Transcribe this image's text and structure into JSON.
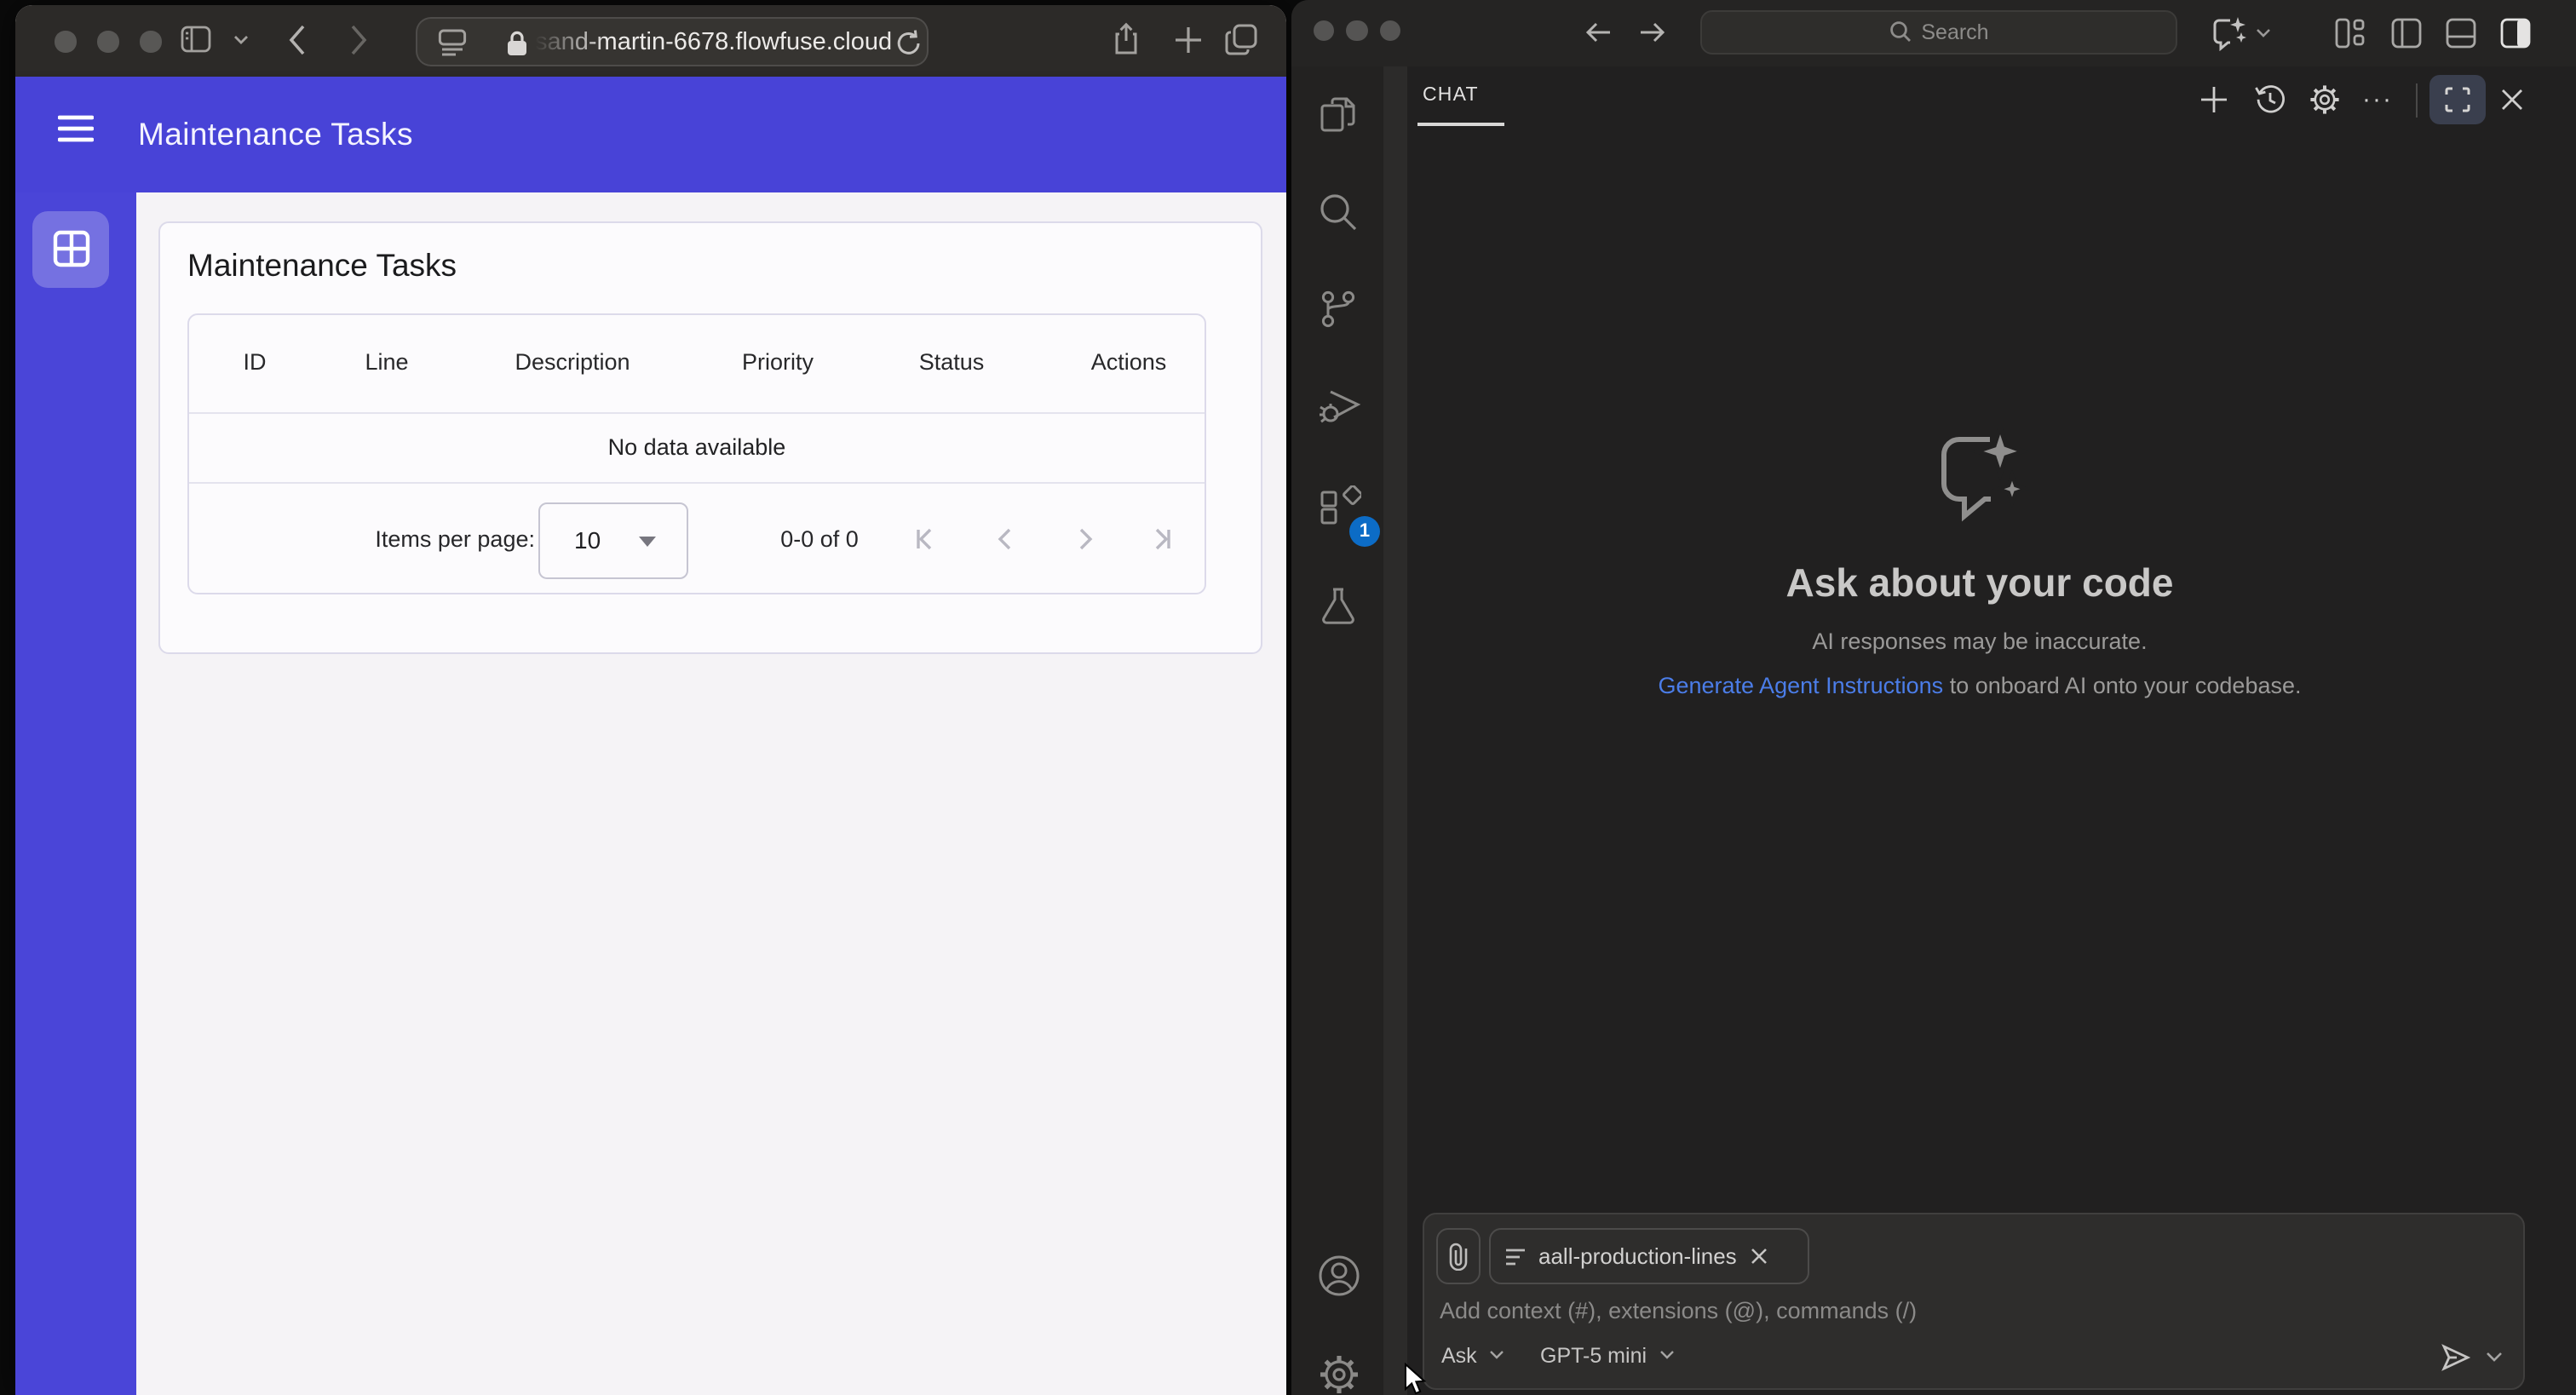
{
  "safari": {
    "url": "sand-martin-6678.flowfuse.cloud",
    "app": {
      "header_title": "Maintenance Tasks",
      "card_title": "Maintenance Tasks",
      "table": {
        "columns": [
          "ID",
          "Line",
          "Description",
          "Priority",
          "Status",
          "Actions"
        ],
        "empty_text": "No data available"
      },
      "pagination": {
        "items_per_page_label": "Items per page:",
        "items_per_page_value": "10",
        "range_text": "0-0 of 0"
      }
    },
    "colors": {
      "primary": "#4843d7"
    }
  },
  "vscode": {
    "titlebar": {
      "search_placeholder": "Search"
    },
    "activity_bar": {
      "extensions_badge": "1"
    },
    "chat": {
      "tab_label": "CHAT",
      "empty_title": "Ask about your code",
      "empty_subtitle": "AI responses may be inaccurate.",
      "empty_link": "Generate Agent Instructions",
      "empty_link_suffix": " to onboard AI onto your codebase.",
      "input": {
        "attachment_name": "aall-production-lines",
        "placeholder": "Add context (#), extensions (@), commands (/)",
        "mode": "Ask",
        "model": "GPT-5 mini"
      }
    },
    "colors": {
      "badge": "#0c6cc6",
      "link": "#4b7de8"
    }
  }
}
